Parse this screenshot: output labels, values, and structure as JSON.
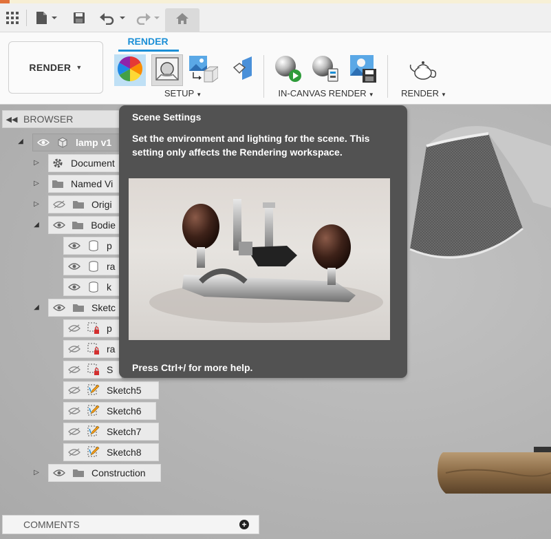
{
  "quick_access": {
    "icons": [
      "app-grid-icon",
      "file-icon",
      "save-icon",
      "undo-icon",
      "redo-icon",
      "home-icon"
    ],
    "accent_color": "#e1713a"
  },
  "ribbon": {
    "workspace_label": "RENDER",
    "active_tab": "RENDER",
    "accent_color": "#1b8fd6",
    "groups": [
      {
        "label": "SETUP",
        "tools": [
          "appearance-tool",
          "scene-settings-tool",
          "texture-map-tool",
          "decal-tool"
        ]
      },
      {
        "label": "IN-CANVAS RENDER",
        "tools": [
          "in-canvas-render-tool",
          "in-canvas-render-settings-tool",
          "capture-image-tool"
        ]
      },
      {
        "label": "RENDER",
        "tools": [
          "render-teapot-tool"
        ]
      }
    ]
  },
  "browser": {
    "header": "BROWSER",
    "root": "lamp v1",
    "items": [
      {
        "label": "Document"
      },
      {
        "label": "Named Vi"
      },
      {
        "label": "Origi"
      },
      {
        "label": "Bodie"
      },
      {
        "label": "p"
      },
      {
        "label": "ra"
      },
      {
        "label": "k"
      },
      {
        "label": "Sketc"
      },
      {
        "label": "p"
      },
      {
        "label": "ra"
      },
      {
        "label": "S"
      },
      {
        "label": "Sketch5"
      },
      {
        "label": "Sketch6"
      },
      {
        "label": "Sketch7"
      },
      {
        "label": "Sketch8"
      },
      {
        "label": "Construction"
      }
    ]
  },
  "comments": {
    "label": "COMMENTS"
  },
  "tooltip": {
    "title": "Scene Settings",
    "body": "Set the environment and lighting for the scene. This setting only affects the Rendering workspace.",
    "help": "Press Ctrl+/ for more help."
  }
}
